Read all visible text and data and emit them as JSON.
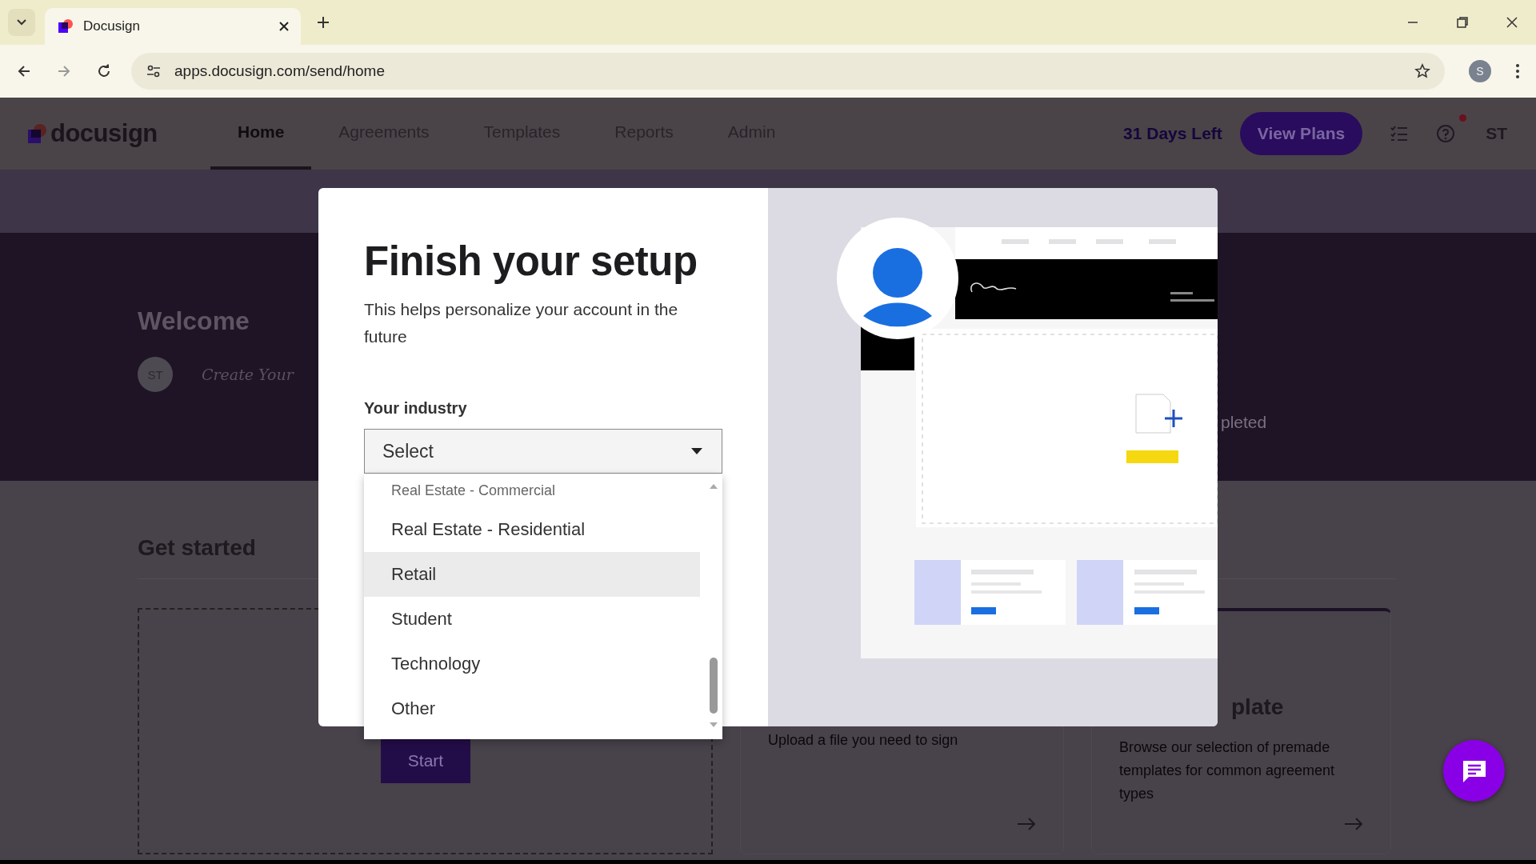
{
  "browser": {
    "tab_title": "Docusign",
    "url": "apps.docusign.com/send/home",
    "profile_initial": "S"
  },
  "app": {
    "logo": "docusign",
    "nav": [
      {
        "label": "Home",
        "selected": true
      },
      {
        "label": "Agreements",
        "selected": false
      },
      {
        "label": "Templates",
        "selected": false
      },
      {
        "label": "Reports",
        "selected": false
      },
      {
        "label": "Admin",
        "selected": false
      }
    ],
    "trial": "31 Days Left",
    "plans_button": "View Plans",
    "avatar": "ST"
  },
  "background": {
    "welcome": "Welcome",
    "avatar": "ST",
    "signature": "Create Your",
    "status_fragment": "pleted",
    "get_started": "Get started",
    "start_button": "Start",
    "cards": [
      {
        "text": "Upload a file you need to sign"
      },
      {
        "heading": "plate",
        "text": "Browse our selection of premade templates for common agreement types"
      }
    ]
  },
  "modal": {
    "title": "Finish your setup",
    "subtitle": "This helps personalize your account in the future",
    "field_label": "Your industry",
    "select": {
      "value": "Select",
      "expanded": true,
      "options": [
        {
          "label": "Real Estate - Commercial",
          "highlighted": false
        },
        {
          "label": "Real Estate - Residential",
          "highlighted": false
        },
        {
          "label": "Retail",
          "highlighted": true
        },
        {
          "label": "Student",
          "highlighted": false
        },
        {
          "label": "Technology",
          "highlighted": false
        },
        {
          "label": "Other",
          "highlighted": false
        }
      ]
    }
  }
}
